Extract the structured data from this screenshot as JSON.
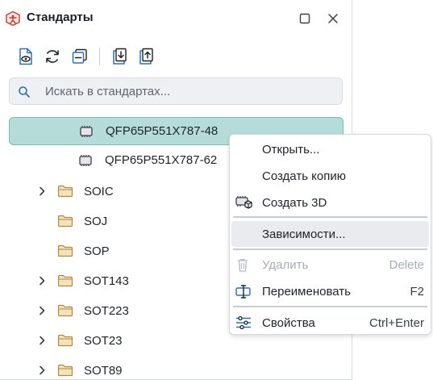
{
  "panel": {
    "title": "Стандарты"
  },
  "toolbar": {
    "buttons": [
      "view-doc-icon",
      "refresh-icon",
      "collapse-icon",
      "import-icon",
      "export-icon"
    ]
  },
  "search": {
    "placeholder": "Искать в стандартах..."
  },
  "tree": {
    "items": [
      {
        "label": "QFP65P551X787-48",
        "kind": "component",
        "selected": true
      },
      {
        "label": "QFP65P551X787-62",
        "kind": "component"
      },
      {
        "label": "SOIC",
        "kind": "folder",
        "expandable": true
      },
      {
        "label": "SOJ",
        "kind": "folder",
        "expandable": false
      },
      {
        "label": "SOP",
        "kind": "folder",
        "expandable": false
      },
      {
        "label": "SOT143",
        "kind": "folder",
        "expandable": true
      },
      {
        "label": "SOT223",
        "kind": "folder",
        "expandable": true
      },
      {
        "label": "SOT23",
        "kind": "folder",
        "expandable": true
      },
      {
        "label": "SOT89",
        "kind": "folder",
        "expandable": true
      }
    ]
  },
  "context_menu": {
    "items": [
      {
        "label": "Открыть...",
        "shortcut": ""
      },
      {
        "label": "Создать копию",
        "shortcut": ""
      },
      {
        "label": "Создать 3D",
        "shortcut": "",
        "icon": "chip-3d-icon"
      },
      {
        "label": "Зависимости...",
        "shortcut": "",
        "highlighted": true
      },
      {
        "label": "Удалить",
        "shortcut": "Delete",
        "icon": "trash-icon",
        "disabled": true
      },
      {
        "label": "Переименовать",
        "shortcut": "F2",
        "icon": "rename-icon"
      },
      {
        "label": "Свойства",
        "shortcut": "Ctrl+Enter",
        "icon": "settings-sliders-icon"
      }
    ]
  },
  "colors": {
    "accent": "#b5dcd9",
    "accent_border": "#7bbab5",
    "logo": "#c0392b",
    "folder": "#d9b87a"
  }
}
